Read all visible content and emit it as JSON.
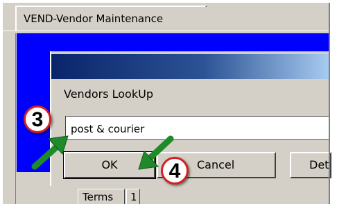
{
  "window": {
    "tab_title": "VEND-Vendor Maintenance"
  },
  "dialog": {
    "label": "Vendors LookUp",
    "search_value": "post & courier",
    "ok_label": "OK",
    "cancel_label": "Cancel",
    "details_label_partial": "Det"
  },
  "bottom_tabs": {
    "terms_label": "Terms",
    "page_number": "1"
  },
  "annotations": {
    "step_a": "3",
    "step_b": "4",
    "badge_border_color": "#d42020",
    "arrow_color": "#1f8a2a"
  },
  "colors": {
    "title_gradient_start": "#0a246a",
    "title_gradient_end": "#a6caf0",
    "background_blue": "#0000ff",
    "control_face": "#d4d0c8"
  }
}
